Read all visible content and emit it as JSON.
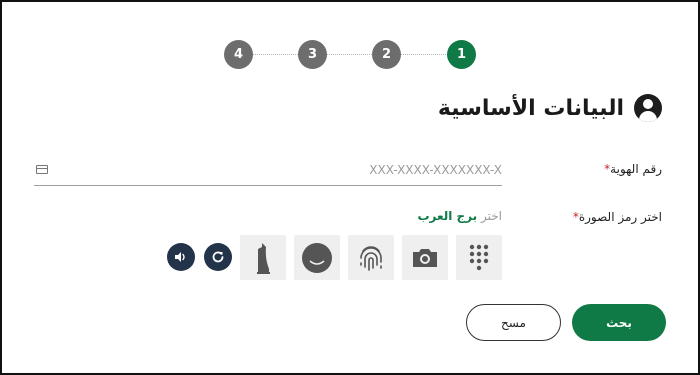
{
  "stepper": {
    "steps": [
      {
        "label": "1",
        "state": "active"
      },
      {
        "label": "2",
        "state": "inactive"
      },
      {
        "label": "3",
        "state": "inactive"
      },
      {
        "label": "4",
        "state": "inactive"
      }
    ],
    "active_color": "#0f7a46",
    "inactive_color": "#6d6d6d"
  },
  "section": {
    "title": "البيانات الأساسية",
    "icon": "user-circle-icon"
  },
  "id_field": {
    "label": "رقم الهوية",
    "required_mark": "*",
    "placeholder": "XXX-XXXX-XXXXXXX-X",
    "value": "",
    "icon": "id-card-icon"
  },
  "captcha": {
    "label": "اختر رمز الصورة",
    "required_mark": "*",
    "hint_prefix": "اختر",
    "hint_target": "برج العرب",
    "options": [
      {
        "name": "keypad-icon"
      },
      {
        "name": "camera-icon"
      },
      {
        "name": "fingerprint-icon"
      },
      {
        "name": "smiley-face-icon"
      },
      {
        "name": "burj-al-arab-icon"
      }
    ],
    "refresh_icon": "refresh-icon",
    "audio_icon": "speaker-icon"
  },
  "actions": {
    "search_label": "بحث",
    "clear_label": "مسح"
  },
  "colors": {
    "primary": "#0f7a46",
    "dark_button": "#23344a",
    "required": "#c62828"
  }
}
